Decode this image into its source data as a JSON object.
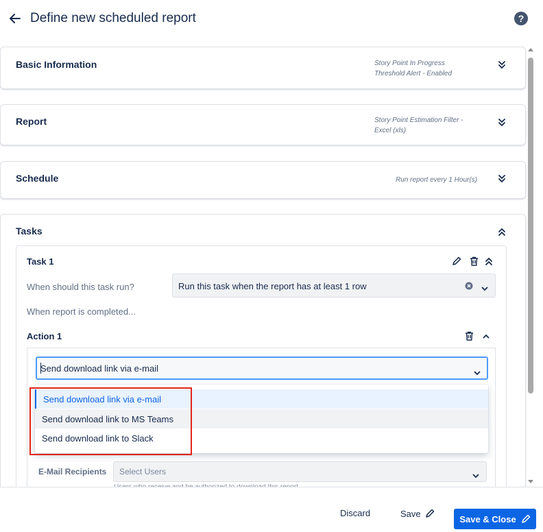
{
  "header": {
    "title": "Define new scheduled report",
    "back_icon": "arrow-left-icon",
    "help_icon": "question-circle-icon",
    "help_glyph": "?"
  },
  "sections": {
    "basic": {
      "title": "Basic Information",
      "summary_line1": "Story Point In Progress",
      "summary_line2": "Threshold Alert - Enabled"
    },
    "report": {
      "title": "Report",
      "summary_line1": "Story Point Estimation Filter -",
      "summary_line2": "Excel (xls)"
    },
    "schedule": {
      "title": "Schedule",
      "summary_line1": "Run report every 1 Hour(s)"
    },
    "tasks": {
      "title": "Tasks"
    }
  },
  "task": {
    "title": "Task 1",
    "run_label": "When should this task run?",
    "run_value": "Run this task when the report has at least 1 row",
    "completed_label": "When report is completed..."
  },
  "action": {
    "title": "Action 1",
    "selected_value": "Send download link via e-mail",
    "options": [
      "Send download link via e-mail",
      "Send download link to MS Teams",
      "Send download link to Slack"
    ],
    "recipients_label": "E-Mail Recipients",
    "recipients_placeholder": "Select Users",
    "recipients_hint": "Users who receive and be authorized to download this report"
  },
  "footer": {
    "discard_label": "Discard",
    "save_label": "Save",
    "save_close_label": "Save & Close"
  },
  "colors": {
    "primary": "#0c66e4",
    "highlight": "#e1251b",
    "text": "#172b4d"
  }
}
